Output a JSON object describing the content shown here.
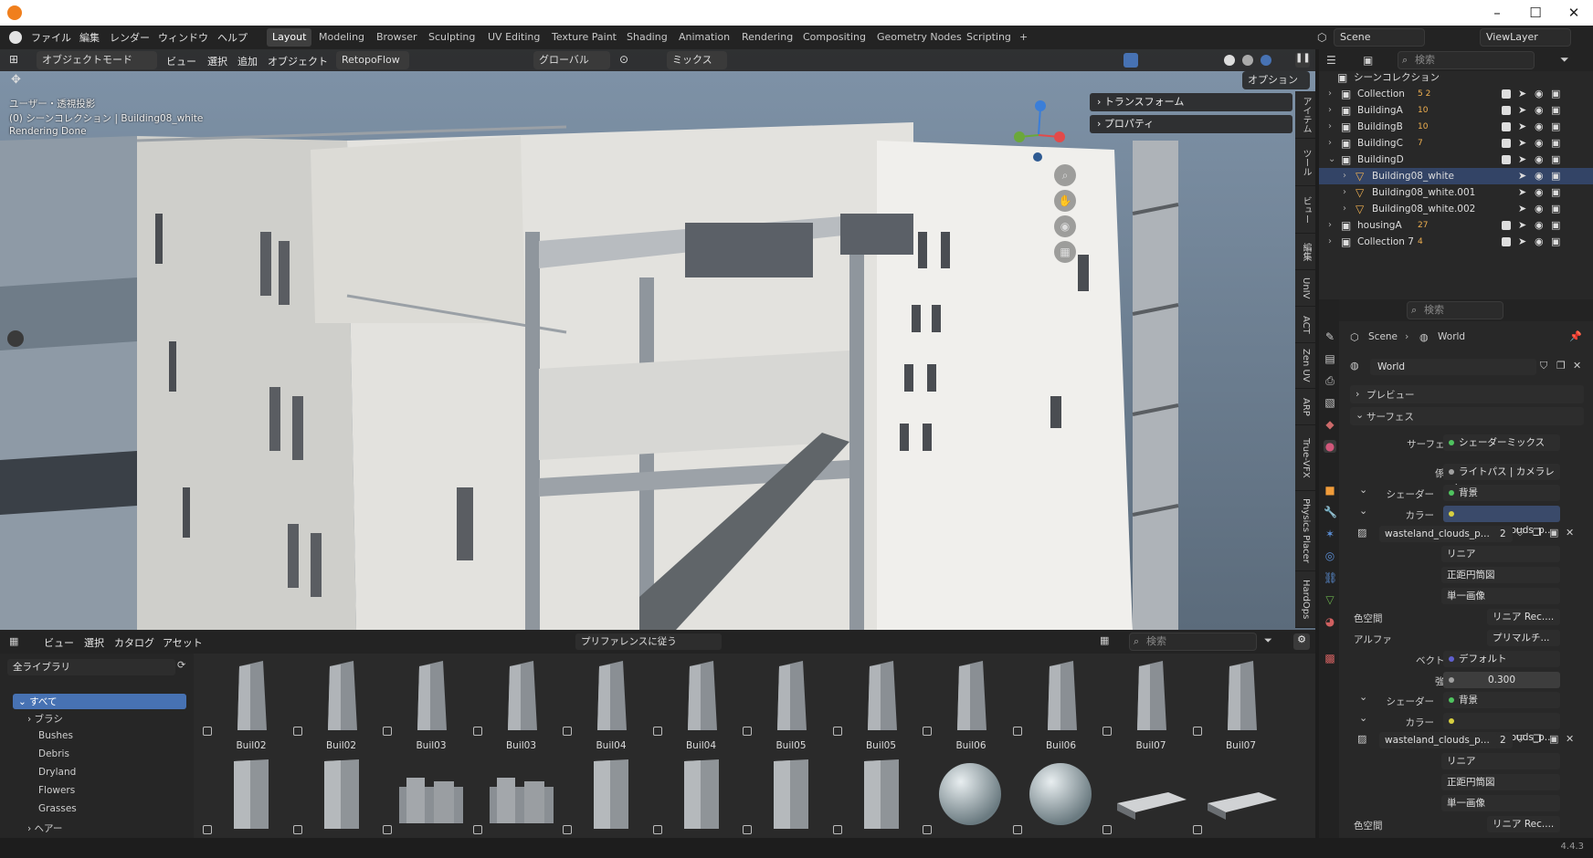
{
  "window": {
    "minimize": "–",
    "maximize": "☐",
    "close": "✕"
  },
  "menu": {
    "file": "ファイル",
    "edit": "編集",
    "render": "レンダー",
    "window": "ウィンドウ",
    "help": "ヘルプ"
  },
  "workspaces": [
    "Layout",
    "Modeling",
    "Browser",
    "Sculpting",
    "UV Editing",
    "Texture Paint",
    "Shading",
    "Animation",
    "Rendering",
    "Compositing",
    "Geometry Nodes",
    "Scripting",
    "+"
  ],
  "scene": {
    "label": "Scene",
    "viewlayer": "ViewLayer"
  },
  "viewport_header": {
    "mode": "オブジェクトモード",
    "view": "ビュー",
    "select": "選択",
    "add": "追加",
    "object": "オブジェクト",
    "retopo": "RetopoFlow",
    "orientation": "グローバル",
    "mix": "ミックス",
    "options": "オプション"
  },
  "viewport_overlay": {
    "line1": "ユーザー・透視投影",
    "line2": "(0) シーンコレクション | Building08_white",
    "line3": "Rendering Done"
  },
  "npanel": {
    "transform": "トランスフォーム",
    "properties": "プロパティ"
  },
  "side_tabs": [
    "アイテム",
    "ツール",
    "ビュー",
    "編集",
    "UnIV",
    "ACT",
    "Zen UV",
    "ARP",
    "True-VFX",
    "Physics Placer",
    "HardOps"
  ],
  "outliner": {
    "search_placeholder": "検索",
    "root": "シーンコレクション",
    "rows": [
      {
        "name": "Collection",
        "extra": "5 2"
      },
      {
        "name": "BuildingA",
        "extra": "10"
      },
      {
        "name": "BuildingB",
        "extra": "10"
      },
      {
        "name": "BuildingC",
        "extra": "7"
      },
      {
        "name": "BuildingD",
        "extra": ""
      },
      {
        "name": "Building08_white",
        "extra": ""
      },
      {
        "name": "Building08_white.001",
        "extra": ""
      },
      {
        "name": "Building08_white.002",
        "extra": ""
      },
      {
        "name": "housingA",
        "extra": "27"
      },
      {
        "name": "Collection 7",
        "extra": "4"
      }
    ]
  },
  "properties": {
    "search_placeholder": "検索",
    "breadcrumb_scene": "Scene",
    "breadcrumb_world": "World",
    "world_name": "World",
    "preview": "プレビュー",
    "surface_section": "サーフェス",
    "surface_label": "サーフェス",
    "surface_value": "シェーダーミックス",
    "factor_label": "係数",
    "factor_value": "ライトパス | カメラレイ",
    "shader_label": "シェーダー",
    "shader_value": "背景",
    "color_label": "カラー",
    "color_value": "wasteland_clouds_p...",
    "image_name": "wasteland_clouds_p...",
    "image_users": "2",
    "interp": "リニア",
    "projection": "正距円筒図",
    "source": "単一画像",
    "colorspace_label": "色空間",
    "colorspace_value": "リニア Rec....",
    "alpha_label": "アルファ",
    "alpha_value": "プリマルチ...",
    "vector_label": "ベクトル",
    "vector_value": "デフォルト",
    "strength_label": "強さ",
    "strength_value": "0.300",
    "shader2_label": "シェーダー",
    "shader2_value": "背景",
    "color2_label": "カラー",
    "color2_value": "wasteland_clouds_p...",
    "image2_name": "wasteland_clouds_p...",
    "image2_users": "2",
    "interp2": "リニア",
    "projection2": "正距円筒図",
    "source2": "単一画像",
    "colorspace2_label": "色空間",
    "colorspace2_value": "リニア Rec...."
  },
  "asset_browser": {
    "view": "ビュー",
    "select": "選択",
    "catalog": "カタログ",
    "asset": "アセット",
    "import": "プリファレンスに従う",
    "search_placeholder": "検索",
    "library": "全ライブラリ",
    "tree": [
      "すべて",
      "ブラシ",
      "Bushes",
      "Debris",
      "Dryland",
      "Flowers",
      "Grasses",
      "ヘアー"
    ],
    "row1": [
      "Buil02",
      "Buil02",
      "Buil03",
      "Buil03",
      "Buil04",
      "Buil04",
      "Buil05",
      "Buil05",
      "Buil06",
      "Buil06",
      "Buil07",
      "Buil07"
    ]
  },
  "status": {
    "version": "4.4.3"
  },
  "colors": {
    "accent": "#4772b3",
    "viewport_sky": "#6f7f8f"
  }
}
